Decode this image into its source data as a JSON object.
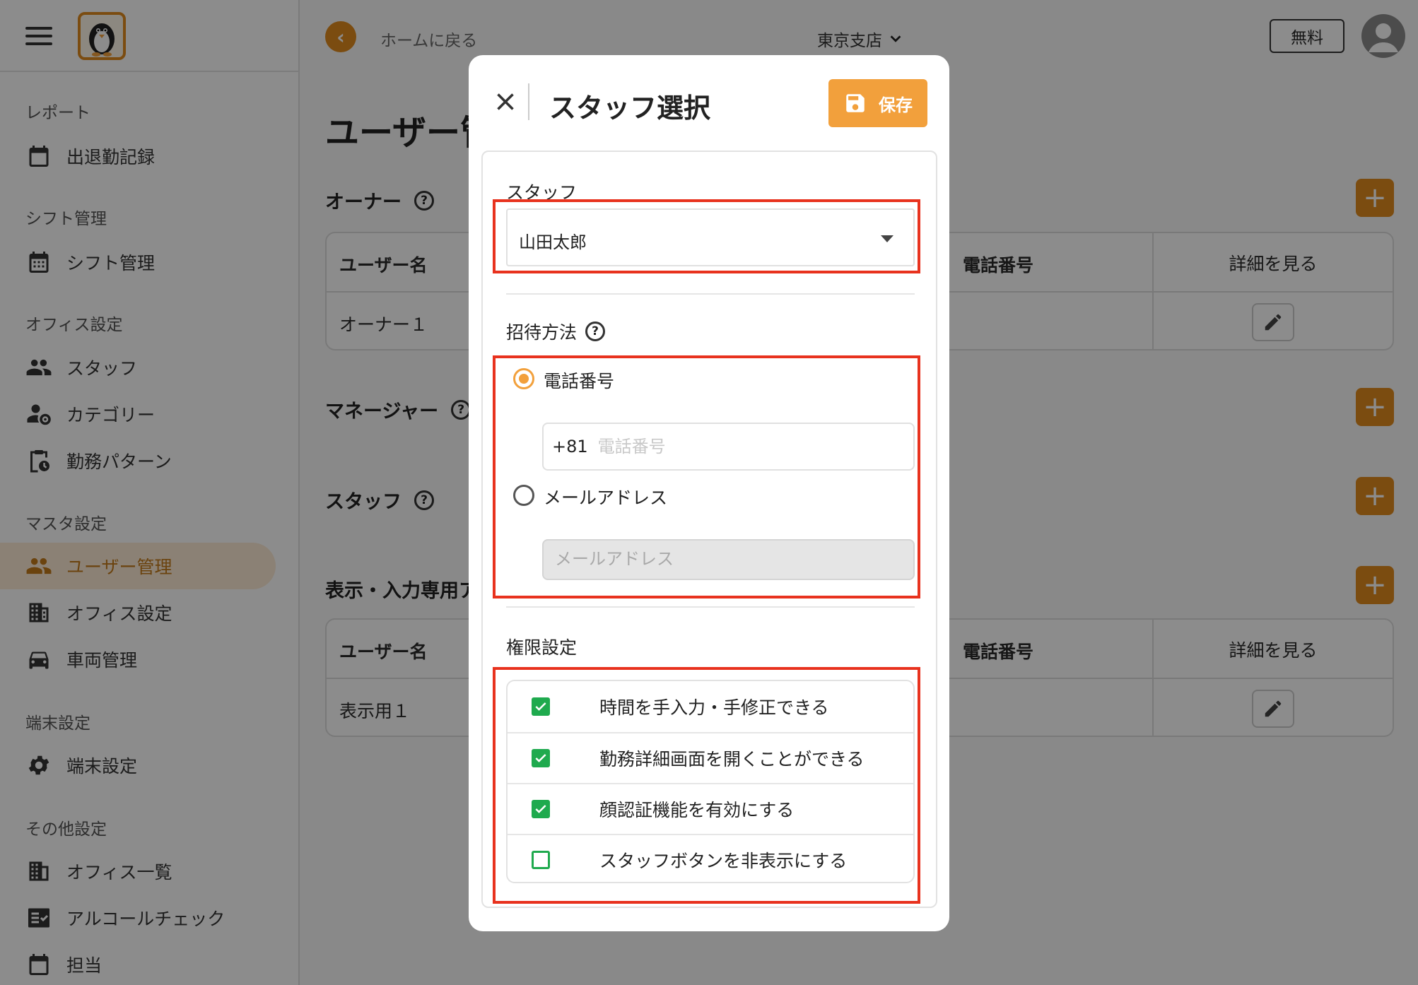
{
  "sidebar": {
    "sections": [
      {
        "title": "レポート",
        "items": [
          {
            "label": "出退勤記録",
            "icon": "calendar-icon"
          }
        ]
      },
      {
        "title": "シフト管理",
        "items": [
          {
            "label": "シフト管理",
            "icon": "calendar-grid-icon"
          }
        ]
      },
      {
        "title": "オフィス設定",
        "items": [
          {
            "label": "スタッフ",
            "icon": "people-icon"
          },
          {
            "label": "カテゴリー",
            "icon": "person-gear-icon"
          },
          {
            "label": "勤務パターン",
            "icon": "clipboard-clock-icon"
          }
        ]
      },
      {
        "title": "マスタ設定",
        "items": [
          {
            "label": "ユーザー管理",
            "icon": "people-icon",
            "active": true
          },
          {
            "label": "オフィス設定",
            "icon": "building-icon"
          },
          {
            "label": "車両管理",
            "icon": "car-icon"
          }
        ]
      },
      {
        "title": "端末設定",
        "items": [
          {
            "label": "端末設定",
            "icon": "gear-icon"
          }
        ]
      },
      {
        "title": "その他設定",
        "items": [
          {
            "label": "オフィス一覧",
            "icon": "building-list-icon"
          },
          {
            "label": "アルコールチェック",
            "icon": "checklist-icon"
          },
          {
            "label": "担当",
            "icon": "calendar-icon"
          }
        ]
      }
    ]
  },
  "header": {
    "back_label": "ホームに戻る",
    "branch": "東京支店",
    "plan_label": "無料"
  },
  "main": {
    "title": "ユーザー管理",
    "sections": {
      "owner": "オーナー",
      "manager": "マネージャー",
      "staff": "スタッフ",
      "display": "表示・入力専用アカウント"
    },
    "tables": {
      "owner": {
        "headers": [
          "ユーザー名",
          "電話番号",
          "詳細を見る"
        ],
        "rows": [
          [
            "オーナー１"
          ]
        ]
      },
      "display": {
        "headers": [
          "ユーザー名",
          "電話番号",
          "詳細を見る"
        ],
        "rows": [
          [
            "表示用１"
          ]
        ]
      }
    }
  },
  "modal": {
    "title": "スタッフ選択",
    "save_label": "保存",
    "staff_label": "スタッフ",
    "staff_value": "山田太郎",
    "invite_label": "招待方法",
    "invite_options": [
      {
        "label": "電話番号",
        "selected": true
      },
      {
        "label": "メールアドレス",
        "selected": false
      }
    ],
    "phone_prefix": "+81",
    "phone_placeholder": "電話番号",
    "email_placeholder": "メールアドレス",
    "permissions_label": "権限設定",
    "permissions": [
      {
        "label": "時間を手入力・手修正できる",
        "checked": true
      },
      {
        "label": "勤務詳細画面を開くことができる",
        "checked": true
      },
      {
        "label": "顔認証機能を有効にする",
        "checked": true
      },
      {
        "label": "スタッフボタンを非表示にする",
        "checked": false
      }
    ]
  },
  "colors": {
    "accent": "#e08a1e",
    "save_button": "#f2a03c",
    "checkbox": "#1faa4e",
    "highlight": "#e8321e"
  }
}
